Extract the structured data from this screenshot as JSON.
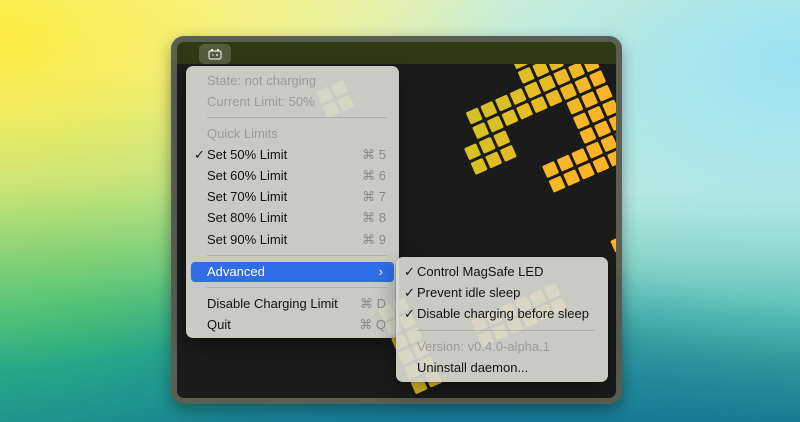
{
  "menubar": {
    "icon": "battery-icon"
  },
  "main_menu": {
    "state": "State: not charging",
    "current_limit": "Current Limit: 50%",
    "quick_limits_header": "Quick Limits",
    "limits": [
      {
        "label": "Set 50% Limit",
        "shortcut": "⌘ 5",
        "checked": true
      },
      {
        "label": "Set 60% Limit",
        "shortcut": "⌘ 6",
        "checked": false
      },
      {
        "label": "Set 70% Limit",
        "shortcut": "⌘ 7",
        "checked": false
      },
      {
        "label": "Set 80% Limit",
        "shortcut": "⌘ 8",
        "checked": false
      },
      {
        "label": "Set 90% Limit",
        "shortcut": "⌘ 9",
        "checked": false
      }
    ],
    "advanced": {
      "label": "Advanced",
      "arrow": "›"
    },
    "disable_limit": {
      "label": "Disable Charging Limit",
      "shortcut": "⌘ D"
    },
    "quit": {
      "label": "Quit",
      "shortcut": "⌘ Q"
    },
    "checkmark": "✓"
  },
  "submenu": {
    "items": [
      {
        "label": "Control MagSafe LED",
        "checked": true
      },
      {
        "label": "Prevent idle sleep",
        "checked": true
      },
      {
        "label": "Disable charging before sleep",
        "checked": true
      }
    ],
    "version": "Version: v0.4.0-alpha.1",
    "uninstall": "Uninstall daemon..."
  },
  "colors": {
    "accent": "#2f6ee6",
    "menu_bg": "#d6d8d0",
    "disabled_text": "#9b9b98"
  }
}
